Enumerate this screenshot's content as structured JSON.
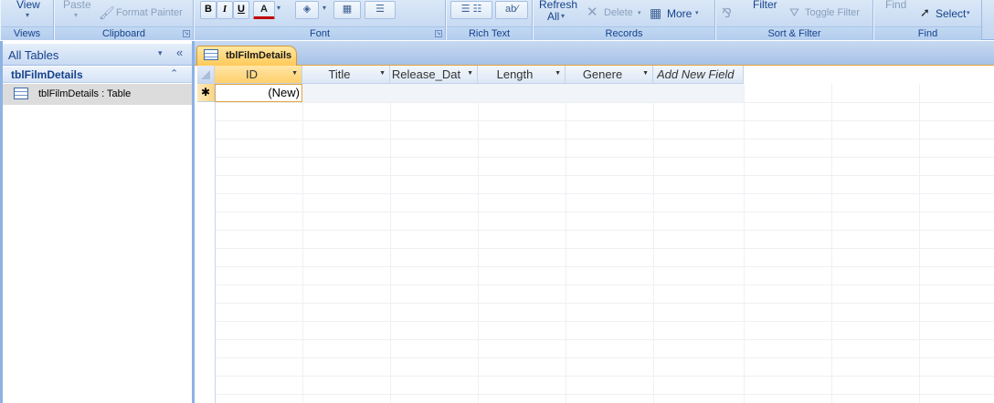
{
  "ribbon": {
    "views": {
      "view_label": "View",
      "group_label": "Views"
    },
    "clipboard": {
      "paste_label": "Paste",
      "format_painter_label": "Format Painter",
      "group_label": "Clipboard"
    },
    "font": {
      "bold": "B",
      "italic": "I",
      "underline": "U",
      "font_color": "A",
      "group_label": "Font"
    },
    "rich_text": {
      "group_label": "Rich Text"
    },
    "records": {
      "refresh_label": "Refresh",
      "refresh_sub": "All",
      "delete_label": "Delete",
      "more_label": "More",
      "group_label": "Records"
    },
    "sort_filter": {
      "filter_label": "Filter",
      "toggle_filter_label": "Toggle Filter",
      "group_label": "Sort & Filter"
    },
    "find": {
      "find_label": "Find",
      "select_label": "Select",
      "group_label": "Find"
    }
  },
  "nav": {
    "title": "All Tables",
    "group_title": "tblFilmDetails",
    "items": [
      {
        "label": "tblFilmDetails : Table"
      }
    ]
  },
  "document": {
    "tab_label": "tblFilmDetails",
    "columns": [
      {
        "label": "ID",
        "has_dropdown": true,
        "selected": true
      },
      {
        "label": "Title",
        "has_dropdown": true
      },
      {
        "label": "Release_Dat",
        "has_dropdown": true
      },
      {
        "label": "Length",
        "has_dropdown": true
      },
      {
        "label": "Genere",
        "has_dropdown": true
      },
      {
        "label": "Add New Field",
        "has_dropdown": false
      }
    ],
    "new_row_marker": "✱",
    "new_row_value": "(New)"
  },
  "colors": {
    "accent": "#ffc958",
    "ribbon": "#c9dcf3",
    "border": "#8db2e3",
    "text": "#15428b"
  }
}
